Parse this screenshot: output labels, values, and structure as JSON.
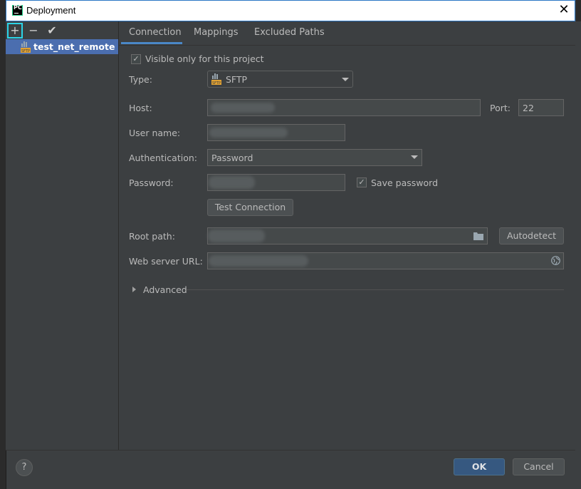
{
  "window": {
    "title": "Deployment"
  },
  "toolbar": {
    "add": "+",
    "remove": "−",
    "apply": "✔"
  },
  "servers": [
    {
      "name": "test_net_remote",
      "icon": "sftp-icon"
    }
  ],
  "tabs": [
    {
      "label": "Connection",
      "active": true
    },
    {
      "label": "Mappings",
      "active": false
    },
    {
      "label": "Excluded Paths",
      "active": false
    }
  ],
  "form": {
    "visible_only_label": "Visible only for this project",
    "visible_only_checked": true,
    "type_label": "Type:",
    "type_value": "SFTP",
    "host_label": "Host:",
    "host_value": "",
    "port_label": "Port:",
    "port_value": "22",
    "username_label": "User name:",
    "username_value": "",
    "auth_label": "Authentication:",
    "auth_value": "Password",
    "password_label": "Password:",
    "password_value": "",
    "save_password_label": "Save password",
    "save_password_checked": true,
    "test_connection_label": "Test Connection",
    "root_path_label": "Root path:",
    "root_path_value": "",
    "autodetect_label": "Autodetect",
    "web_url_label": "Web server URL:",
    "web_url_value": "",
    "advanced_label": "Advanced"
  },
  "footer": {
    "help": "?",
    "ok": "OK",
    "cancel": "Cancel"
  },
  "colors": {
    "accent": "#4b6eaf",
    "ok_button": "#365880",
    "highlight": "#2bd4e8"
  }
}
